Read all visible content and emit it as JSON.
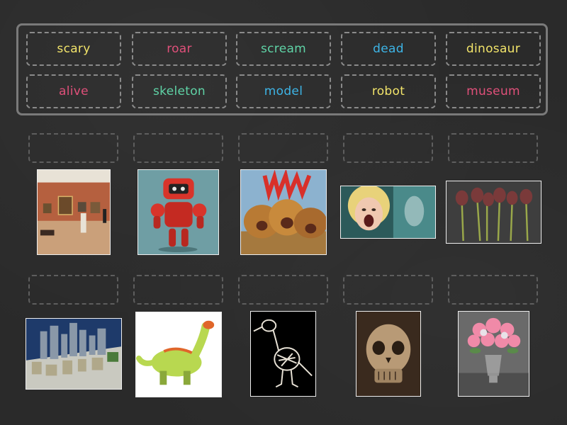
{
  "word_bank": [
    {
      "label": "scary",
      "color": "#f2e46a"
    },
    {
      "label": "roar",
      "color": "#e0507a"
    },
    {
      "label": "scream",
      "color": "#5fd3a6"
    },
    {
      "label": "dead",
      "color": "#3db4e6"
    },
    {
      "label": "dinosaur",
      "color": "#f2e46a"
    },
    {
      "label": "alive",
      "color": "#e0507a"
    },
    {
      "label": "skeleton",
      "color": "#5fd3a6"
    },
    {
      "label": "model",
      "color": "#3db4e6"
    },
    {
      "label": "robot",
      "color": "#f2e46a"
    },
    {
      "label": "museum",
      "color": "#e0507a"
    }
  ],
  "images": [
    {
      "row": 1,
      "subject": "museum-gallery-photo"
    },
    {
      "row": 1,
      "subject": "red-robot-photo"
    },
    {
      "row": 1,
      "subject": "roaring-lions-poster"
    },
    {
      "row": 1,
      "subject": "screaming-woman-photo"
    },
    {
      "row": 1,
      "subject": "dead-roses-photo"
    },
    {
      "row": 2,
      "subject": "city-model-photo"
    },
    {
      "row": 2,
      "subject": "toy-dinosaur-photo"
    },
    {
      "row": 2,
      "subject": "bird-skeleton-photo"
    },
    {
      "row": 2,
      "subject": "scary-skull-photo"
    },
    {
      "row": 2,
      "subject": "fresh-flowers-vase-photo"
    }
  ]
}
